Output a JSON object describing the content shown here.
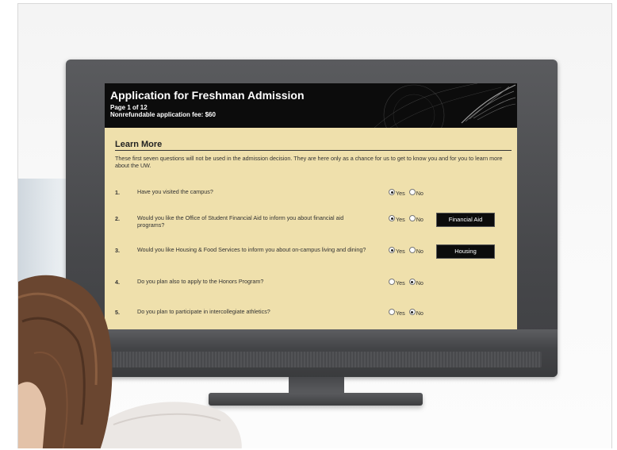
{
  "app": {
    "title": "Application for Freshman Admission",
    "page": "Page 1 of 12",
    "fee": "Nonrefundable application fee: $60"
  },
  "section": {
    "title": "Learn More",
    "intro": "These first seven questions will not be used in the admission decision. They are here only as a chance for us to get to know you and for you to learn more about the UW."
  },
  "questions": [
    {
      "num": "1.",
      "text": "Have you visited the campus?",
      "yes_label": "Yes",
      "no_label": "No",
      "selected": "yes",
      "button": null
    },
    {
      "num": "2.",
      "text": "Would you like the Office of Student Financial Aid to inform you about financial aid programs?",
      "yes_label": "Yes",
      "no_label": "No",
      "selected": "yes",
      "button": "Financial Aid"
    },
    {
      "num": "3.",
      "text": "Would you like Housing & Food Services to inform you about on-campus living and dining?",
      "yes_label": "Yes",
      "no_label": "No",
      "selected": "yes",
      "button": "Housing"
    },
    {
      "num": "4.",
      "text": "Do you plan also to apply to the Honors Program?",
      "yes_label": "Yes",
      "no_label": "No",
      "selected": "no",
      "button": null
    },
    {
      "num": "5.",
      "text": "Do you plan to participate in intercollegiate athletics?",
      "yes_label": "Yes",
      "no_label": "No",
      "selected": "no",
      "button": null
    }
  ],
  "colors": {
    "screen_bg": "#efe0ac",
    "header_bg": "#0c0c0c",
    "button_bg": "#0c0c0c"
  }
}
